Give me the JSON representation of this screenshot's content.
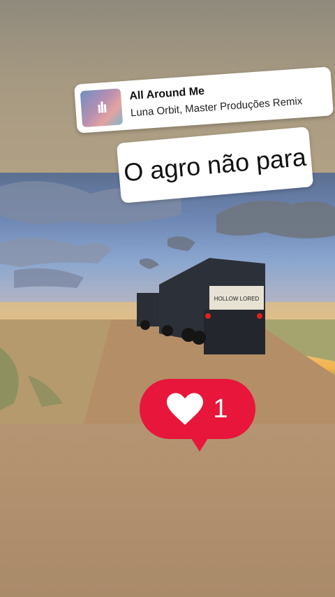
{
  "music": {
    "title": "All Around Me",
    "artist": "Luna Orbit, Master Produções Remix"
  },
  "caption": {
    "text": "O agro não para"
  },
  "like": {
    "count": "1",
    "color": "#e8163a"
  },
  "photo": {
    "truck_plate_text": "HOLLOW LORED"
  }
}
